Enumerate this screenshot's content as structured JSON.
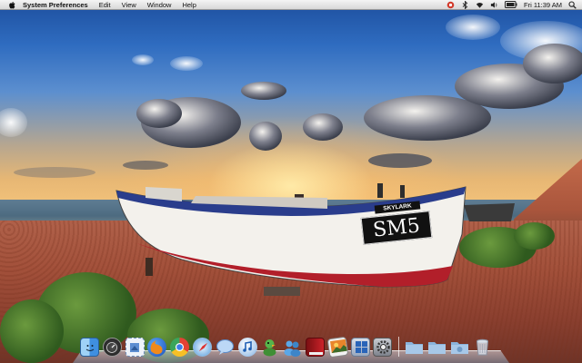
{
  "menubar": {
    "apple_icon": "apple-icon",
    "app_name": "System Preferences",
    "menus": [
      "Edit",
      "View",
      "Window",
      "Help"
    ],
    "status_icons": [
      "record-icon",
      "bluetooth-icon",
      "wifi-icon",
      "volume-icon",
      "battery-icon"
    ],
    "clock": "Fri 11:39 AM",
    "spotlight_icon": "spotlight-icon"
  },
  "wallpaper": {
    "boat_name": "SKYLARK",
    "boat_number": "SM5"
  },
  "dock": {
    "items": [
      {
        "name": "finder",
        "icon": "finder-icon"
      },
      {
        "name": "dashboard",
        "icon": "dashboard-icon"
      },
      {
        "name": "mail",
        "icon": "mail-stamp-icon"
      },
      {
        "name": "firefox",
        "icon": "firefox-icon"
      },
      {
        "name": "chrome",
        "icon": "chrome-icon"
      },
      {
        "name": "safari",
        "icon": "safari-icon"
      },
      {
        "name": "ichat",
        "icon": "chat-bubble-icon"
      },
      {
        "name": "itunes",
        "icon": "itunes-icon"
      },
      {
        "name": "adium",
        "icon": "duck-icon"
      },
      {
        "name": "address-book",
        "icon": "people-icon"
      },
      {
        "name": "photo-booth",
        "icon": "red-book-icon"
      },
      {
        "name": "iphoto",
        "icon": "photos-icon"
      },
      {
        "name": "windows-app",
        "icon": "windows-icon"
      },
      {
        "name": "system-preferences",
        "icon": "gear-icon"
      },
      {
        "name": "applications-folder",
        "icon": "folder-icon"
      },
      {
        "name": "documents-folder",
        "icon": "folder-icon"
      },
      {
        "name": "downloads-folder",
        "icon": "downloads-folder-icon"
      },
      {
        "name": "trash",
        "icon": "trash-icon"
      }
    ]
  }
}
